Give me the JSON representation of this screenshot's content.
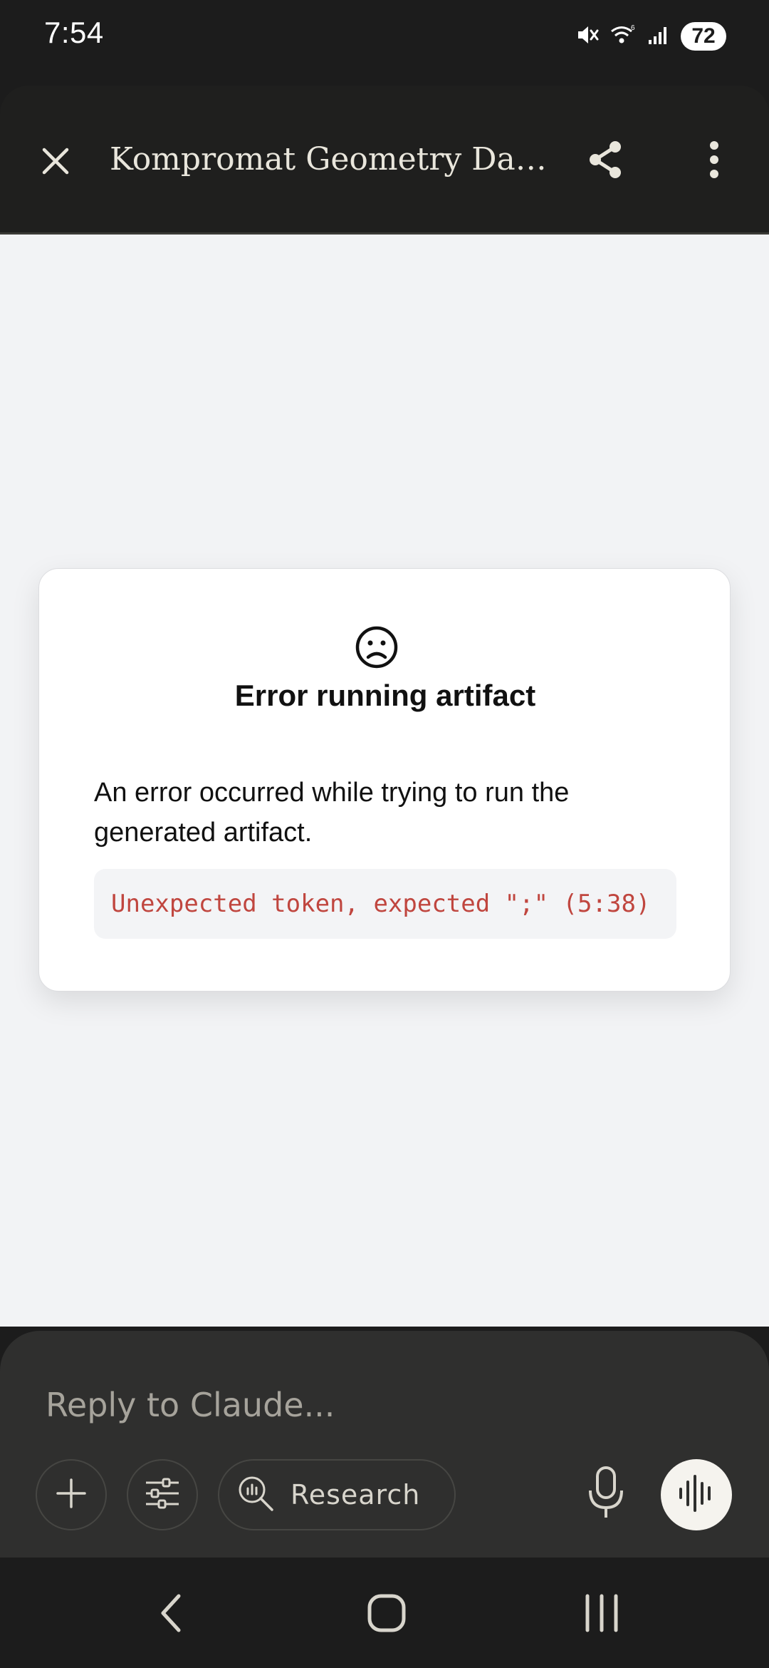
{
  "status_bar": {
    "time": "7:54",
    "battery": "72",
    "icons": [
      "mute-icon",
      "wifi-icon",
      "signal-icon",
      "battery-icon"
    ]
  },
  "header": {
    "title": "Kompromat Geometry Data...",
    "icons": [
      "close-icon",
      "share-icon",
      "more-vertical-icon"
    ]
  },
  "error": {
    "icon": "sad-face-icon",
    "title": "Error running artifact",
    "description": "An error occurred while trying to run the generated artifact.",
    "code": "Unexpected token, expected \";\" (5:38)"
  },
  "composer": {
    "placeholder": "Reply to Claude...",
    "research_label": "Research",
    "icons": [
      "plus-icon",
      "sliders-icon",
      "research-icon",
      "microphone-icon",
      "voice-wave-icon"
    ]
  },
  "nav": {
    "icons": [
      "back-icon",
      "home-icon",
      "recent-apps-icon"
    ]
  },
  "colors": {
    "header_bg": "#1f1f1e",
    "content_bg": "#f2f3f5",
    "error_code": "#c0463f",
    "composer_bg": "#2f2f2e"
  }
}
